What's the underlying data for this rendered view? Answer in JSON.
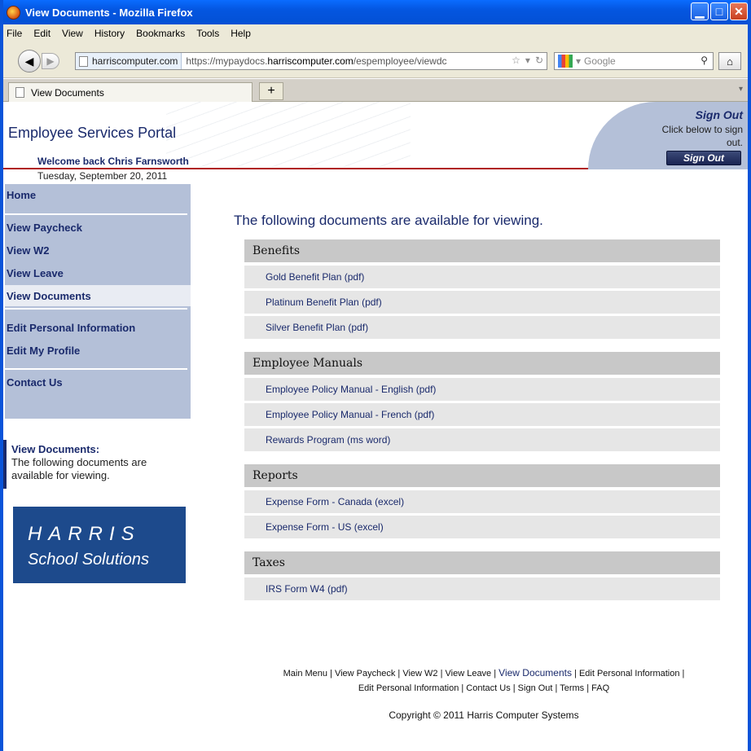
{
  "window": {
    "title": "View Documents - Mozilla Firefox"
  },
  "menu": [
    "File",
    "Edit",
    "View",
    "History",
    "Bookmarks",
    "Tools",
    "Help"
  ],
  "navbar": {
    "site_label": "harriscomputer.com",
    "url_prefix": "https://mypaydocs.",
    "url_domain": "harriscomputer.com",
    "url_suffix": "/espemployee/viewdc",
    "search_placeholder": "Google"
  },
  "tab": {
    "label": "View Documents"
  },
  "header": {
    "portal_title": "Employee Services Portal",
    "welcome": "Welcome back Chris Farnsworth",
    "date": "Tuesday, September 20, 2011",
    "signout_heading": "Sign Out",
    "signout_sub": "Click below to sign out.",
    "signout_button": "Sign Out"
  },
  "sidebar": {
    "items": [
      {
        "label": "Home"
      },
      {
        "label": "View Paycheck"
      },
      {
        "label": "View W2"
      },
      {
        "label": "View Leave"
      },
      {
        "label": "View Documents"
      },
      {
        "label": "Edit Personal Information"
      },
      {
        "label": "Edit My Profile"
      },
      {
        "label": "Contact Us"
      }
    ],
    "info_title": "View Documents:",
    "info_text": "The following documents are available for viewing.",
    "logo_line1": "HARRIS",
    "logo_line2": "School Solutions"
  },
  "main": {
    "title": "The following documents are available for viewing.",
    "sections": [
      {
        "heading": "Benefits",
        "docs": [
          "Gold Benefit Plan (pdf)",
          "Platinum Benefit Plan (pdf)",
          "Silver Benefit Plan (pdf)"
        ]
      },
      {
        "heading": "Employee Manuals",
        "docs": [
          "Employee Policy Manual - English (pdf)",
          "Employee Policy Manual - French (pdf)",
          "Rewards Program (ms word)"
        ]
      },
      {
        "heading": "Reports",
        "docs": [
          "Expense Form - Canada (excel)",
          "Expense Form - US (excel)"
        ]
      },
      {
        "heading": "Taxes",
        "docs": [
          "IRS Form W4 (pdf)"
        ]
      }
    ]
  },
  "footer": {
    "links_a": "Main Menu | View Paycheck | View W2 | View Leave | ",
    "current": "View Documents",
    "links_b": " | Edit Personal Information |",
    "line2": "Edit Personal Information | Contact Us | Sign Out | Terms | FAQ",
    "copyright": "Copyright © 2011 Harris Computer Systems"
  }
}
